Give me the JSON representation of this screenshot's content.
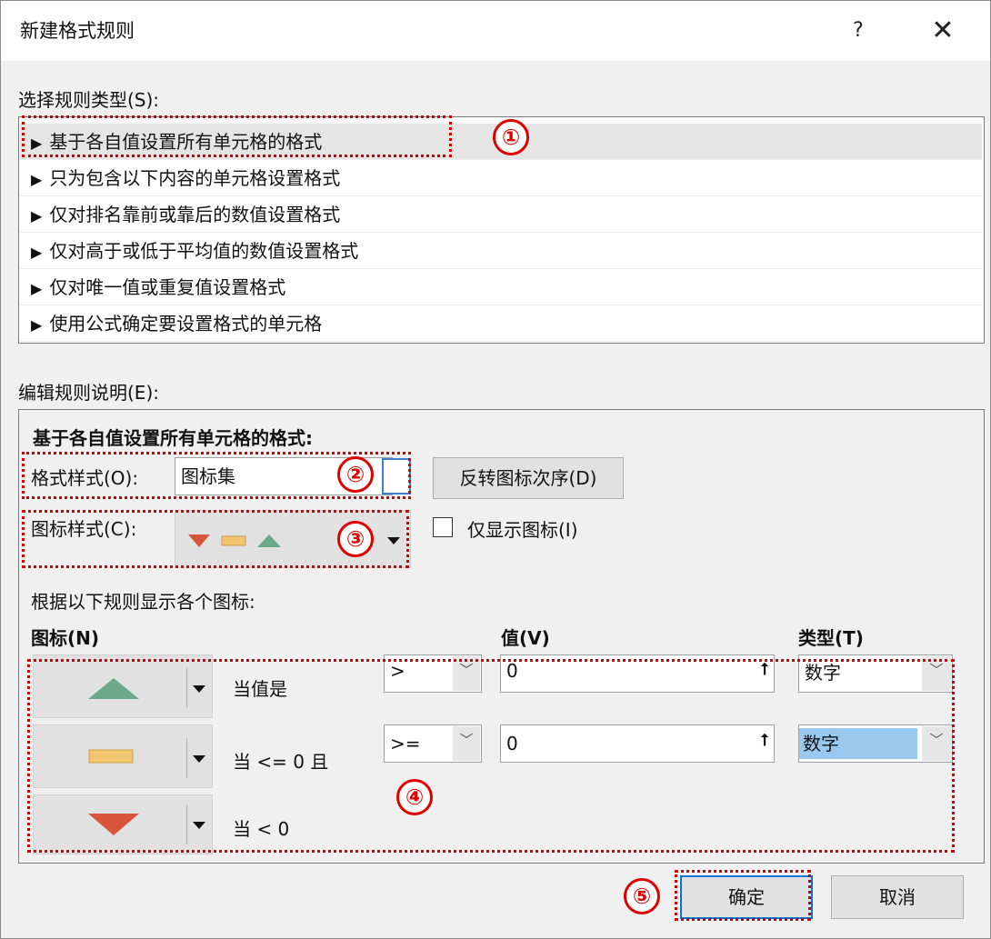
{
  "dialog": {
    "title": "新建格式规则",
    "help": "?",
    "close": "✕"
  },
  "rule_type": {
    "label": "选择规则类型(S):",
    "items": [
      {
        "label": "基于各自值设置所有单元格的格式",
        "selected": true
      },
      {
        "label": "只为包含以下内容的单元格设置格式"
      },
      {
        "label": "仅对排名靠前或靠后的数值设置格式"
      },
      {
        "label": "仅对高于或低于平均值的数值设置格式"
      },
      {
        "label": "仅对唯一值或重复值设置格式"
      },
      {
        "label": "使用公式确定要设置格式的单元格"
      }
    ],
    "arrow": "▶"
  },
  "edit": {
    "label": "编辑规则说明(E):",
    "heading": "基于各自值设置所有单元格的格式:",
    "format_style_label": "格式样式(O):",
    "format_style_value": "图标集",
    "reverse_button": "反转图标次序(D)",
    "icon_style_label": "图标样式(C):",
    "show_icon_only_label": "仅显示图标(I)",
    "show_icon_only_checked": false,
    "rules_caption": "根据以下规则显示各个图标:",
    "col_icon": "图标(N)",
    "col_value": "值(V)",
    "col_type": "类型(T)",
    "rows": [
      {
        "icon": "green-up-triangle",
        "condition": "当值是",
        "operator": ">",
        "value": "0",
        "type": "数字"
      },
      {
        "icon": "yellow-bar",
        "condition": "当 <= 0 且",
        "operator": ">=",
        "value": "0",
        "type": "数字"
      },
      {
        "icon": "red-down-triangle",
        "condition": "当 < 0"
      }
    ]
  },
  "buttons": {
    "ok": "确定",
    "cancel": "取消"
  },
  "annotations": [
    "①",
    "②",
    "③",
    "④",
    "⑤"
  ],
  "colors": {
    "green": "#6aa98a",
    "yellow": "#f2c56f",
    "red": "#d9553a",
    "annotation_red": "#e00000",
    "selection_blue": "#99c9ef"
  }
}
